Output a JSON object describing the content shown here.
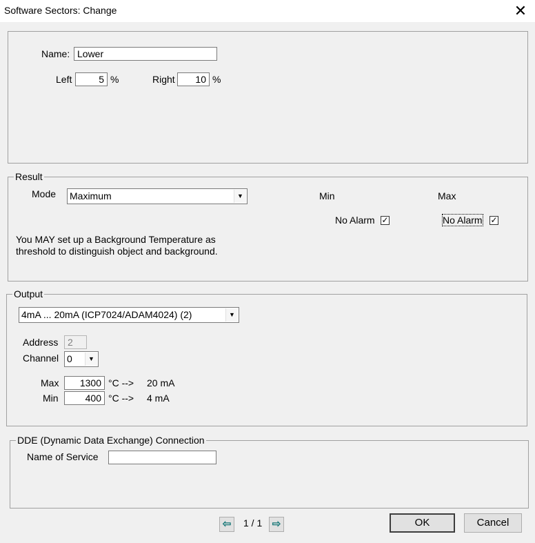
{
  "window": {
    "title": "Software Sectors: Change",
    "close_glyph": "✕"
  },
  "sector": {
    "name_label": "Name:",
    "name_value": "Lower",
    "left_label": "Left",
    "left_value": "5",
    "left_unit": "%",
    "right_label": "Right",
    "right_value": "10",
    "right_unit": "%"
  },
  "result": {
    "legend": "Result",
    "mode_label": "Mode",
    "mode_value": "Maximum",
    "min_label": "Min",
    "max_label": "Max",
    "min_alarm_label": "No Alarm",
    "min_alarm_checked": true,
    "max_alarm_label": "No Alarm",
    "max_alarm_checked": true,
    "note_line1": "You MAY set up a Background Temperature as",
    "note_line2": "threshold to distinguish object and background."
  },
  "output": {
    "legend": "Output",
    "type_value": "4mA ... 20mA (ICP7024/ADAM4024) (2)",
    "address_label": "Address",
    "address_value": "2",
    "channel_label": "Channel",
    "channel_value": "0",
    "max_label": "Max",
    "max_value": "1300",
    "max_arrow": "°C -->",
    "max_target": "20 mA",
    "min_label": "Min",
    "min_value": "400",
    "min_arrow": "°C -->",
    "min_target": "4 mA"
  },
  "dde": {
    "legend": "DDE (Dynamic Data Exchange) Connection",
    "service_label": "Name of Service",
    "service_value": ""
  },
  "footer": {
    "page_indicator": "1 / 1",
    "prev_glyph": "⇦",
    "next_glyph": "⇨",
    "ok_label": "OK",
    "cancel_label": "Cancel"
  },
  "colors": {
    "accent_arrow": "#1a7a7a",
    "check_glyph": "✓"
  }
}
